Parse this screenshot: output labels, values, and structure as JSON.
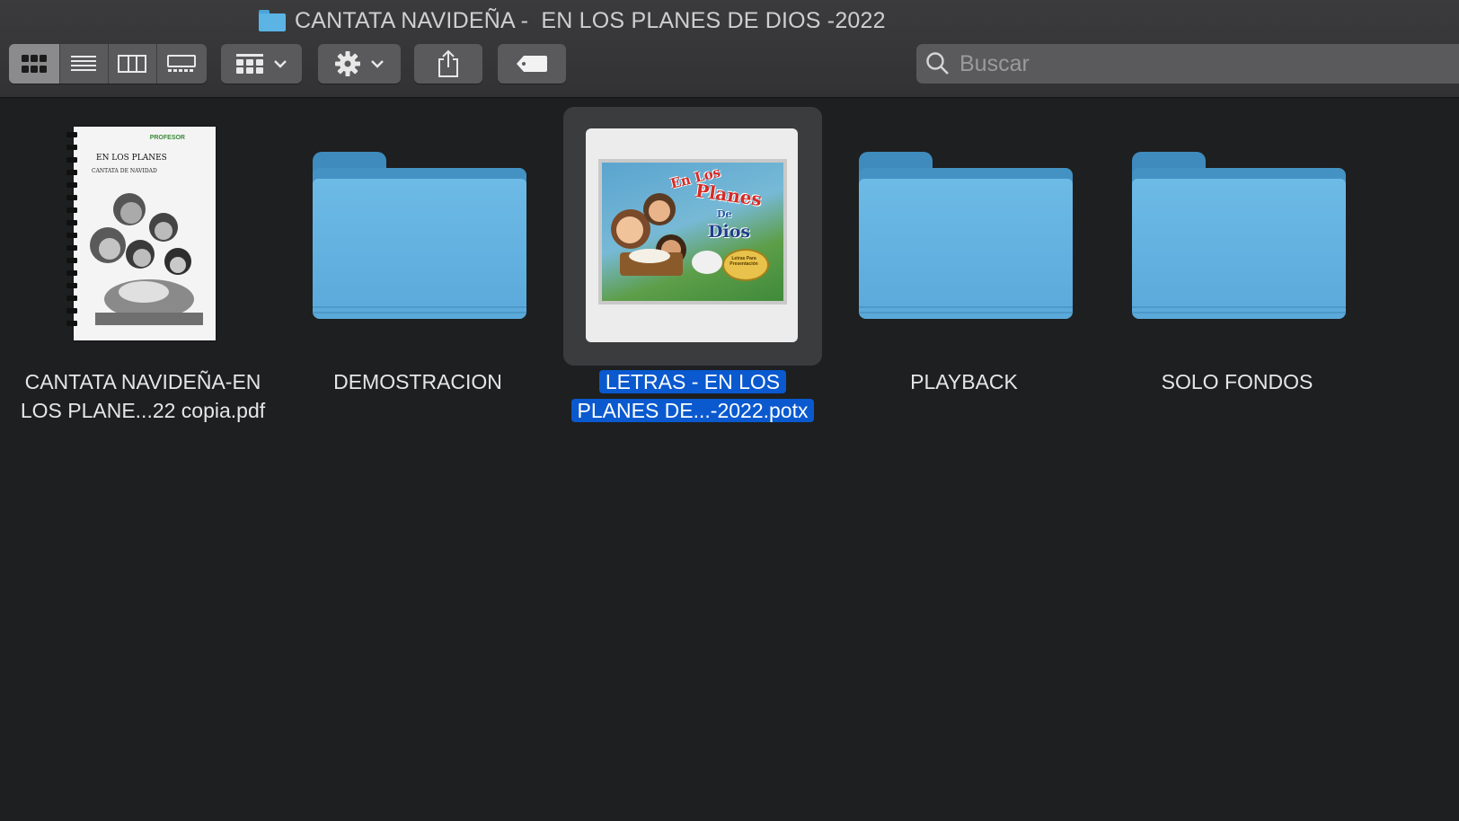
{
  "window": {
    "title": "CANTATA NAVIDEÑA -  EN LOS PLANES DE DIOS -2022"
  },
  "toolbar": {
    "view_modes": [
      {
        "name": "icon-view",
        "active": true
      },
      {
        "name": "list-view",
        "active": false
      },
      {
        "name": "column-view",
        "active": false
      },
      {
        "name": "gallery-view",
        "active": false
      }
    ],
    "group_button_icon": "group-grid-icon",
    "action_button_icon": "gear-icon",
    "share_button_icon": "share-icon",
    "tag_button_icon": "tag-icon"
  },
  "search": {
    "placeholder": "Buscar",
    "value": ""
  },
  "files": [
    {
      "type": "pdf",
      "label_line1": "CANTATA NAVIDEÑA-EN",
      "label_line2": "LOS PLANE...22 copia.pdf",
      "selected": false
    },
    {
      "type": "folder",
      "label_line1": "DEMOSTRACION",
      "selected": false
    },
    {
      "type": "potx",
      "label_line1": "LETRAS - EN LOS",
      "label_line2": "PLANES DE...-2022.potx",
      "selected": true
    },
    {
      "type": "folder",
      "label_line1": "PLAYBACK",
      "selected": false
    },
    {
      "type": "folder",
      "label_line1": "SOLO FONDOS",
      "selected": false
    }
  ],
  "pdf_thumb": {
    "corner_text": "PROFESOR",
    "title": "EN LOS PLANES",
    "subtitle": "CANTATA DE NAVIDAD"
  },
  "potx_thumb": {
    "line1": "En Los",
    "line2": "Planes",
    "line3": "De",
    "line4": "Dios",
    "badge": "Letras Para Presentación"
  },
  "colors": {
    "selection": "#0a59cf",
    "folder": "#6dbae6",
    "toolbar": "#5a5a5d"
  }
}
